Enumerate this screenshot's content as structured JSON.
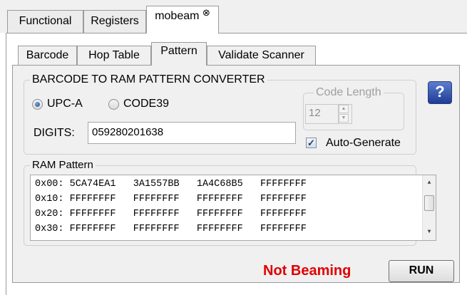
{
  "outer_tabs": [
    {
      "label": "Functional"
    },
    {
      "label": "Registers"
    },
    {
      "label": "mobeam",
      "close_glyph": "⊗"
    }
  ],
  "inner_tabs": [
    {
      "label": "Barcode"
    },
    {
      "label": "Hop Table"
    },
    {
      "label": "Pattern"
    },
    {
      "label": "Validate Scanner"
    }
  ],
  "converter": {
    "title": "BARCODE TO RAM PATTERN CONVERTER",
    "radio_options": [
      "UPC-A",
      "CODE39"
    ],
    "selected": "UPC-A",
    "digits_label": "DIGITS:",
    "digits_value": "059280201638",
    "code_length_label": "Code Length",
    "code_length_value": "12",
    "auto_generate_label": "Auto-Generate",
    "auto_generate_checked": true
  },
  "ram_pattern": {
    "title": "RAM Pattern",
    "rows": [
      {
        "addr": "0x00:",
        "words": [
          "5CA74EA1",
          "3A1557BB",
          "1A4C68B5",
          "FFFFFFFF"
        ]
      },
      {
        "addr": "0x10:",
        "words": [
          "FFFFFFFF",
          "FFFFFFFF",
          "FFFFFFFF",
          "FFFFFFFF"
        ]
      },
      {
        "addr": "0x20:",
        "words": [
          "FFFFFFFF",
          "FFFFFFFF",
          "FFFFFFFF",
          "FFFFFFFF"
        ]
      },
      {
        "addr": "0x30:",
        "words": [
          "FFFFFFFF",
          "FFFFFFFF",
          "FFFFFFFF",
          "FFFFFFFF"
        ]
      }
    ]
  },
  "help": {
    "glyph": "?",
    "icon": "help-icon"
  },
  "status": {
    "text": "Not Beaming",
    "color": "#e00000"
  },
  "run_button": {
    "label": "RUN"
  }
}
